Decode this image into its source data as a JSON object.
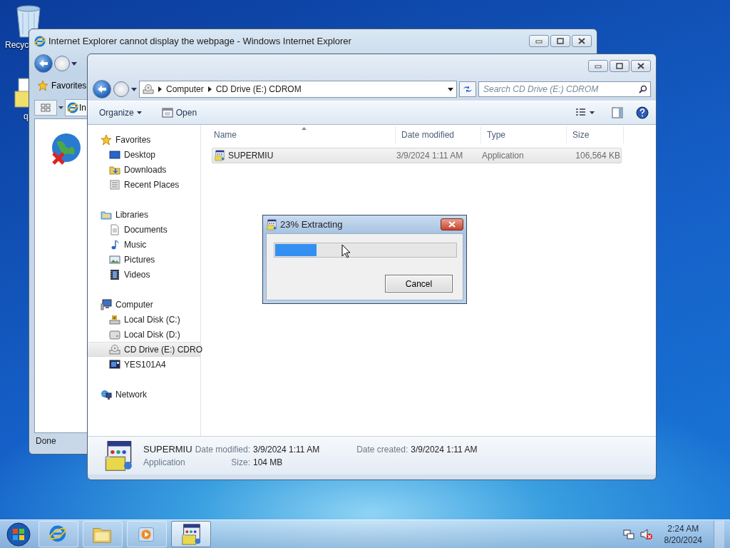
{
  "desktop": {
    "icons": [
      {
        "kind": "recycle-bin",
        "label": "Recyc"
      },
      {
        "kind": "file",
        "label": "q"
      }
    ]
  },
  "ie_window": {
    "title": "Internet Explorer cannot display the webpage - Windows Internet Explorer",
    "favorites": "Favorites",
    "tab": "In",
    "status": "Done"
  },
  "explorer": {
    "breadcrumb": [
      "Computer",
      "CD Drive (E:) CDROM"
    ],
    "search": {
      "placeholder": "Search CD Drive (E:) CDROM"
    },
    "toolbar": [
      {
        "kind": "menu",
        "label": "Organize"
      },
      {
        "kind": "open",
        "label": "Open"
      }
    ],
    "nav": [
      {
        "kind": "favorites",
        "label": "Favorites",
        "selected": false,
        "children": [
          {
            "kind": "desktop",
            "label": "Desktop",
            "selected": false
          },
          {
            "kind": "downloads",
            "label": "Downloads",
            "selected": false
          },
          {
            "kind": "recent",
            "label": "Recent Places",
            "selected": false
          }
        ]
      },
      {
        "kind": "libraries",
        "label": "Libraries",
        "selected": false,
        "children": [
          {
            "kind": "documents",
            "label": "Documents",
            "selected": false
          },
          {
            "kind": "music",
            "label": "Music",
            "selected": false
          },
          {
            "kind": "pictures",
            "label": "Pictures",
            "selected": false
          },
          {
            "kind": "videos",
            "label": "Videos",
            "selected": false
          }
        ]
      },
      {
        "kind": "computer",
        "label": "Computer",
        "selected": false,
        "children": [
          {
            "kind": "system-disk",
            "label": "Local Disk (C:)",
            "selected": false
          },
          {
            "kind": "disk",
            "label": "Local Disk (D:)",
            "selected": false
          },
          {
            "kind": "cd",
            "label": "CD Drive (E:) CDRO",
            "selected": true
          },
          {
            "kind": "display",
            "label": "YES101A4",
            "selected": false
          }
        ]
      },
      {
        "kind": "network",
        "label": "Network",
        "selected": false
      }
    ],
    "columns": [
      {
        "label": "Name",
        "sorted": true
      },
      {
        "label": "Date modified",
        "sorted": false
      },
      {
        "label": "Type",
        "sorted": false
      },
      {
        "label": "Size",
        "sorted": false
      }
    ],
    "files": [
      {
        "name": "SUPERMIU",
        "date": "3/9/2024 1:11 AM",
        "type": "Application",
        "size": "106,564 KB",
        "selected": true
      }
    ],
    "details": {
      "name": "SUPERMIU",
      "type": "Application",
      "fields": [
        {
          "label": "Date modified:",
          "value": "3/9/2024 1:11 AM"
        },
        {
          "label": "Size:",
          "value": "104 MB"
        },
        {
          "label": "Date created:",
          "value": "3/9/2024 1:11 AM"
        }
      ]
    }
  },
  "dialog": {
    "title": "23% Extracting",
    "level": 0.23,
    "button": "Cancel"
  },
  "taskbar": {
    "apps": [
      {
        "kind": "browser",
        "selected": false
      },
      {
        "kind": "folder",
        "selected": false
      },
      {
        "kind": "media",
        "selected": false
      },
      {
        "kind": "installer",
        "selected": true
      }
    ],
    "clock": {
      "time": "2:24 AM",
      "date": "8/20/2024"
    }
  }
}
